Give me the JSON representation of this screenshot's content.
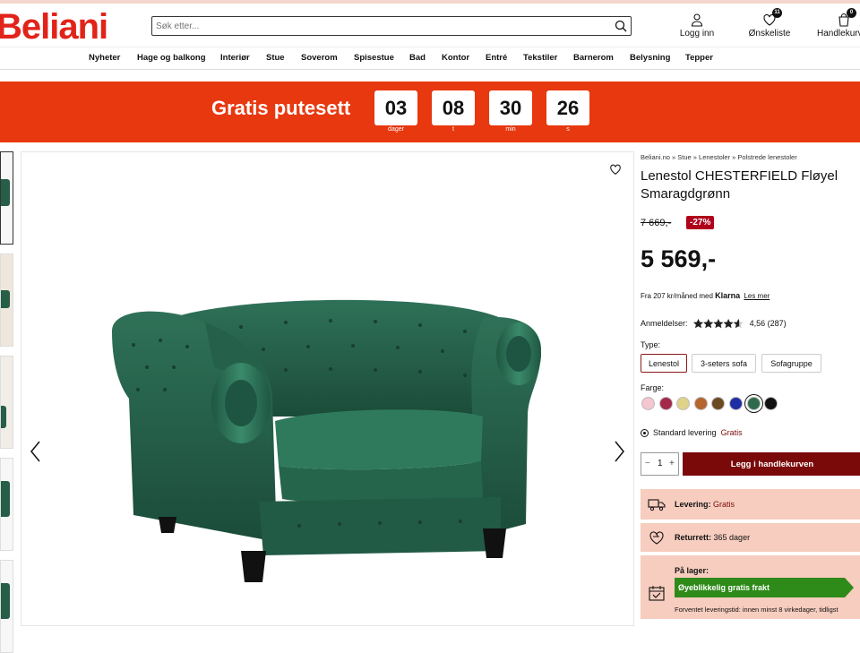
{
  "header": {
    "logo": "Beliani",
    "search_placeholder": "Søk etter...",
    "login_label": "Logg inn",
    "wishlist_label": "Ønskeliste",
    "wishlist_count": "11",
    "cart_label": "Handlekurv",
    "cart_count": "0"
  },
  "nav": [
    "Nyheter",
    "Hage og balkong",
    "Interiør",
    "Stue",
    "Soverom",
    "Spisestue",
    "Bad",
    "Kontor",
    "Entré",
    "Tekstiler",
    "Barnerom",
    "Belysning",
    "Tepper"
  ],
  "banner": {
    "title": "Gratis putesett",
    "countdown": [
      {
        "value": "03",
        "unit": "dager"
      },
      {
        "value": "08",
        "unit": "t"
      },
      {
        "value": "30",
        "unit": "min"
      },
      {
        "value": "26",
        "unit": "s"
      }
    ]
  },
  "product": {
    "breadcrumb": "Beliani.no » Stue » Lenestoler » Polstrede lenestoler",
    "title": "Lenestol CHESTERFIELD Fløyel Smaragdgrønn",
    "old_price": "7 669,-",
    "discount": "-27%",
    "price": "5 569,-",
    "klarna_prefix": "Fra 207 kr/måned med",
    "klarna_brand": "Klarna",
    "klarna_link": "Les mer",
    "reviews_label": "Anmeldelser:",
    "rating_value": 4.56,
    "rating_text": "4,56 (287)",
    "type_label": "Type:",
    "types": [
      "Lenestol",
      "3-seters sofa",
      "Sofagruppe"
    ],
    "selected_type": "Lenestol",
    "color_label": "Farge:",
    "colors": [
      "#f4c6cf",
      "#a3284a",
      "#e0d28a",
      "#b5652e",
      "#6b4a22",
      "#1f2fa3",
      "#2e6b4c",
      "#111111"
    ],
    "selected_color": "#2e6b4c",
    "delivery_label": "Standard levering",
    "delivery_price": "Gratis",
    "quantity": "1",
    "qty_minus": "−",
    "qty_plus": "+",
    "add_to_cart": "Legg i handlekurven",
    "shipping_label": "Levering:",
    "shipping_value": "Gratis",
    "return_label": "Returrett:",
    "return_value": "365 dager",
    "stock_label": "På lager:",
    "stock_bar": "Øyeblikkelig gratis frakt",
    "delivery_time": "Forventet leveringstid: innen minst 8 virkedager, tidligst"
  }
}
